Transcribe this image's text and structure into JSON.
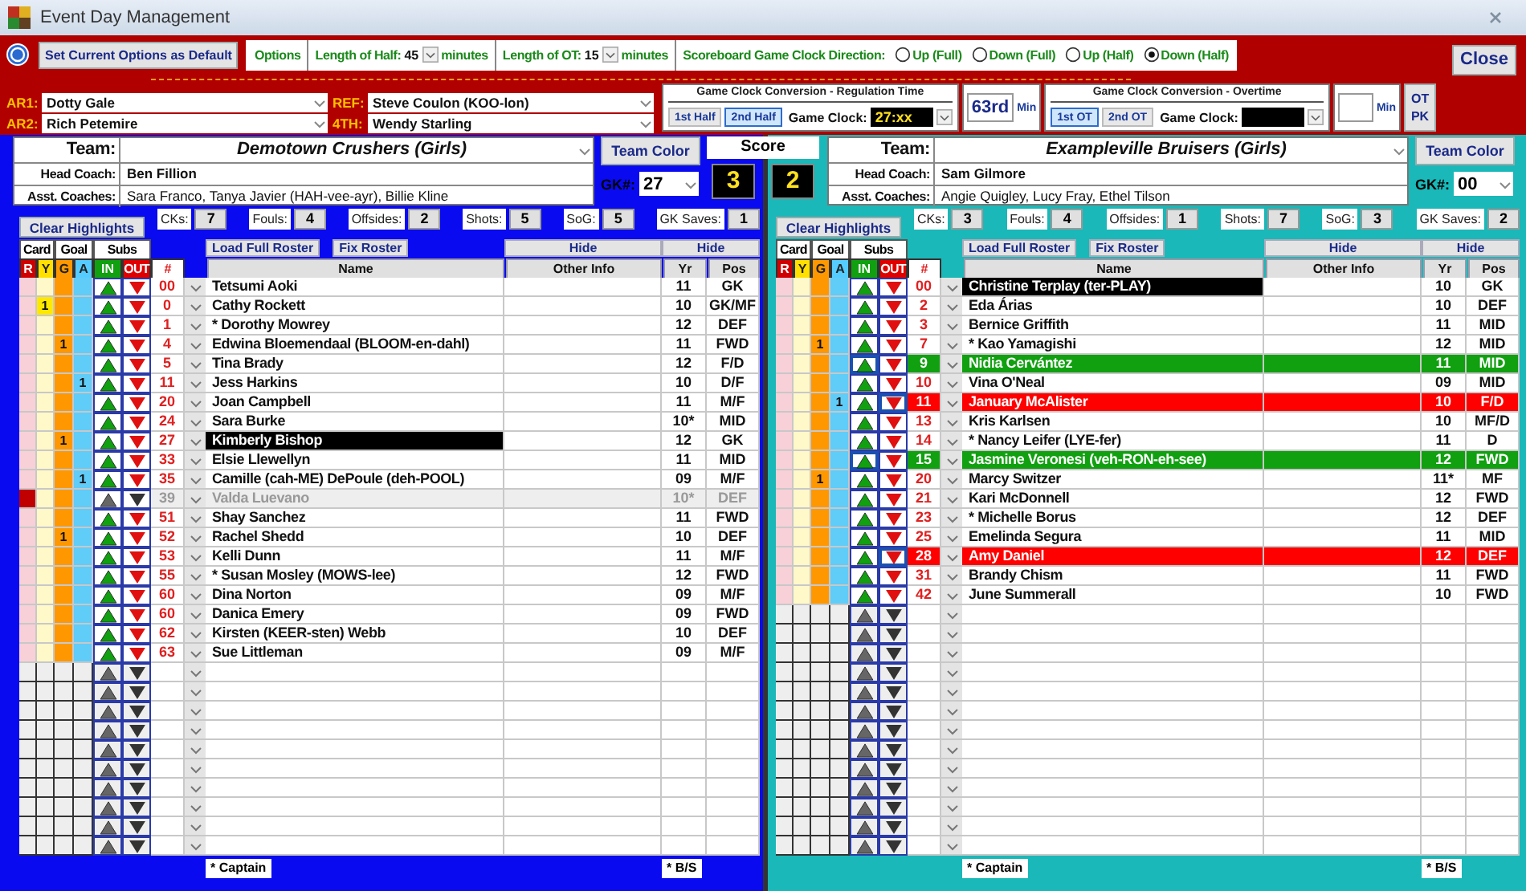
{
  "window": {
    "title": "Event Day Management"
  },
  "options": {
    "default_button": "Set Current Options as Default",
    "label": "Options",
    "half_label": "Length of Half:",
    "half_value": "45",
    "half_unit": "minutes",
    "ot_label": "Length of OT:",
    "ot_value": "15",
    "ot_unit": "minutes",
    "direction_label": "Scoreboard Game Clock Direction:",
    "directions": [
      {
        "label": "Up (Full)",
        "selected": false
      },
      {
        "label": "Down (Full)",
        "selected": false
      },
      {
        "label": "Up (Half)",
        "selected": false
      },
      {
        "label": "Down (Half)",
        "selected": true
      }
    ]
  },
  "close_button": "Close",
  "officials": [
    {
      "role": "AR1:",
      "name": "Dotty Gale"
    },
    {
      "role": "AR2:",
      "name": "Rich Petemire"
    },
    {
      "role": "REF:",
      "name": "Steve Coulon (KOO-lon)"
    },
    {
      "role": "4TH:",
      "name": "Wendy Starling"
    }
  ],
  "regulation": {
    "title": "Game Clock Conversion - Regulation Time",
    "periods": [
      {
        "label": "1st Half",
        "selected": false
      },
      {
        "label": "2nd Half",
        "selected": true
      }
    ],
    "clock_label": "Game Clock:",
    "clock_value": "27:xx",
    "minute": "63rd",
    "minute_unit": "Min"
  },
  "overtime": {
    "title": "Game Clock Conversion - Overtime",
    "periods": [
      {
        "label": "1st OT",
        "selected": true
      },
      {
        "label": "2nd OT",
        "selected": false
      }
    ],
    "clock_label": "Game Clock:",
    "minute_unit": "Min"
  },
  "ot_pk_button": "OT PK",
  "score": {
    "label": "Score",
    "home": "3",
    "away": "2"
  },
  "teams": [
    {
      "color": "#0a0af0",
      "team_label": "Team:",
      "name": "Demotown Crushers (Girls)",
      "color_button": "Team Color",
      "head_coach_label": "Head Coach:",
      "head_coach": "Ben Fillion",
      "asst_label": "Asst. Coaches:",
      "asst": "Sara Franco, Tanya Javier (HAH-vee-ayr), Billie Kline",
      "gk_label": "GK#:",
      "gk": "27",
      "stats": [
        {
          "label": "CKs:",
          "value": "7"
        },
        {
          "label": "Fouls:",
          "value": "4"
        },
        {
          "label": "Offsides:",
          "value": "2"
        },
        {
          "label": "Shots:",
          "value": "5"
        },
        {
          "label": "SoG:",
          "value": "5"
        },
        {
          "label": "GK Saves:",
          "value": "1"
        }
      ],
      "clear_button": "Clear Highlights",
      "group_headers": [
        "Card",
        "Goal",
        "Subs"
      ],
      "load_button": "Load Full Roster",
      "fix_button": "Fix Roster",
      "hide_buttons": [
        "Hide",
        "Hide"
      ],
      "columns": [
        "R",
        "Y",
        "G",
        "A",
        "IN",
        "OUT",
        "#",
        "Name",
        "Other Info",
        "Yr",
        "Pos"
      ],
      "players": [
        {
          "kind": "player",
          "num": "00",
          "name": "Tetsumi Aoki",
          "yr": "11",
          "pos": "GK",
          "red_card": false,
          "in_goal": false,
          "subbed_in": false,
          "subbed_out": false
        },
        {
          "kind": "player",
          "num": "0",
          "name": "Cathy Rockett",
          "yr": "10",
          "pos": "GK/MF",
          "red_card": false,
          "in_goal": false,
          "subbed_in": false,
          "subbed_out": false,
          "yellow": "1"
        },
        {
          "kind": "player",
          "num": "1",
          "name": "* Dorothy Mowrey",
          "yr": "12",
          "pos": "DEF",
          "red_card": false,
          "in_goal": false,
          "subbed_in": false,
          "subbed_out": false
        },
        {
          "kind": "player",
          "num": "4",
          "name": "Edwina Bloemendaal (BLOOM-en-dahl)",
          "yr": "11",
          "pos": "FWD",
          "red_card": false,
          "in_goal": false,
          "subbed_in": false,
          "subbed_out": false,
          "goals": "1"
        },
        {
          "kind": "player",
          "num": "5",
          "name": "Tina Brady",
          "yr": "12",
          "pos": "F/D",
          "red_card": false,
          "in_goal": false,
          "subbed_in": false,
          "subbed_out": false
        },
        {
          "kind": "player",
          "num": "11",
          "name": "Jess Harkins",
          "yr": "10",
          "pos": "D/F",
          "red_card": false,
          "in_goal": false,
          "subbed_in": false,
          "subbed_out": false,
          "assists": "1"
        },
        {
          "kind": "player",
          "num": "20",
          "name": "Joan Campbell",
          "yr": "11",
          "pos": "M/F",
          "red_card": false,
          "in_goal": false,
          "subbed_in": false,
          "subbed_out": false
        },
        {
          "kind": "player",
          "num": "24",
          "name": "Sara Burke",
          "yr": "10*",
          "pos": "MID",
          "red_card": false,
          "in_goal": false,
          "subbed_in": false,
          "subbed_out": false
        },
        {
          "kind": "player",
          "num": "27",
          "name": "Kimberly Bishop",
          "yr": "12",
          "pos": "GK",
          "red_card": false,
          "in_goal": true,
          "subbed_in": false,
          "subbed_out": false,
          "goals": "1"
        },
        {
          "kind": "player",
          "num": "33",
          "name": "Elsie Llewellyn",
          "yr": "11",
          "pos": "MID",
          "red_card": false,
          "in_goal": false,
          "subbed_in": false,
          "subbed_out": false
        },
        {
          "kind": "player",
          "num": "35",
          "name": "Camille (cah-ME) DePoule (deh-POOL)",
          "yr": "09",
          "pos": "M/F",
          "red_card": false,
          "in_goal": false,
          "subbed_in": false,
          "subbed_out": false,
          "assists": "1"
        },
        {
          "kind": "player",
          "num": "39",
          "name": "Valda Luevano",
          "yr": "10*",
          "pos": "DEF",
          "red_card": true,
          "in_goal": false,
          "subbed_in": false,
          "subbed_out": false
        },
        {
          "kind": "player",
          "num": "51",
          "name": "Shay Sanchez",
          "yr": "11",
          "pos": "FWD",
          "red_card": false,
          "in_goal": false,
          "subbed_in": false,
          "subbed_out": false
        },
        {
          "kind": "player",
          "num": "52",
          "name": "Rachel Shedd",
          "yr": "10",
          "pos": "DEF",
          "red_card": false,
          "in_goal": false,
          "subbed_in": false,
          "subbed_out": false,
          "goals": "1"
        },
        {
          "kind": "player",
          "num": "53",
          "name": "Kelli Dunn",
          "yr": "11",
          "pos": "M/F",
          "red_card": false,
          "in_goal": false,
          "subbed_in": false,
          "subbed_out": false
        },
        {
          "kind": "player",
          "num": "55",
          "name": "* Susan Mosley (MOWS-lee)",
          "yr": "12",
          "pos": "FWD",
          "red_card": false,
          "in_goal": false,
          "subbed_in": false,
          "subbed_out": false
        },
        {
          "kind": "player",
          "num": "60",
          "name": "Dina Norton",
          "yr": "09",
          "pos": "M/F",
          "red_card": false,
          "in_goal": false,
          "subbed_in": false,
          "subbed_out": false
        },
        {
          "kind": "player",
          "num": "60",
          "name": "Danica Emery",
          "yr": "09",
          "pos": "FWD",
          "red_card": false,
          "in_goal": false,
          "subbed_in": false,
          "subbed_out": false
        },
        {
          "kind": "player",
          "num": "62",
          "name": "Kirsten (KEER-sten) Webb",
          "yr": "10",
          "pos": "DEF",
          "red_card": false,
          "in_goal": false,
          "subbed_in": false,
          "subbed_out": false
        },
        {
          "kind": "player",
          "num": "63",
          "name": "Sue Littleman",
          "yr": "09",
          "pos": "M/F",
          "red_card": false,
          "in_goal": false,
          "subbed_in": false,
          "subbed_out": false
        },
        {
          "kind": "blank"
        },
        {
          "kind": "blank"
        },
        {
          "kind": "blank"
        },
        {
          "kind": "blank"
        },
        {
          "kind": "blank"
        },
        {
          "kind": "blank"
        },
        {
          "kind": "blank"
        },
        {
          "kind": "blank"
        },
        {
          "kind": "blank"
        },
        {
          "kind": "blank"
        }
      ],
      "footer": [
        "* Captain",
        "* B/S"
      ]
    },
    {
      "color": "#1ab8b8",
      "team_label": "Team:",
      "name": "Exampleville Bruisers (Girls)",
      "color_button": "Team Color",
      "head_coach_label": "Head Coach:",
      "head_coach": "Sam Gilmore",
      "asst_label": "Asst. Coaches:",
      "asst": "Angie Quigley, Lucy Fray, Ethel Tilson",
      "gk_label": "GK#:",
      "gk": "00",
      "stats": [
        {
          "label": "CKs:",
          "value": "3"
        },
        {
          "label": "Fouls:",
          "value": "4"
        },
        {
          "label": "Offsides:",
          "value": "1"
        },
        {
          "label": "Shots:",
          "value": "7"
        },
        {
          "label": "SoG:",
          "value": "3"
        },
        {
          "label": "GK Saves:",
          "value": "2"
        }
      ],
      "clear_button": "Clear Highlights",
      "group_headers": [
        "Card",
        "Goal",
        "Subs"
      ],
      "load_button": "Load Full Roster",
      "fix_button": "Fix Roster",
      "hide_buttons": [
        "Hide",
        "Hide"
      ],
      "columns": [
        "R",
        "Y",
        "G",
        "A",
        "IN",
        "OUT",
        "#",
        "Name",
        "Other Info",
        "Yr",
        "Pos"
      ],
      "players": [
        {
          "kind": "player",
          "num": "00",
          "name": "Christine Terplay (ter-PLAY)",
          "yr": "10",
          "pos": "GK",
          "red_card": false,
          "in_goal": true,
          "subbed_in": false,
          "subbed_out": false
        },
        {
          "kind": "player",
          "num": "2",
          "name": "Eda Árias",
          "yr": "10",
          "pos": "DEF",
          "red_card": false,
          "in_goal": false,
          "subbed_in": false,
          "subbed_out": false
        },
        {
          "kind": "player",
          "num": "3",
          "name": "Bernice Griffith",
          "yr": "11",
          "pos": "MID",
          "red_card": false,
          "in_goal": false,
          "subbed_in": false,
          "subbed_out": false
        },
        {
          "kind": "player",
          "num": "7",
          "name": "* Kao Yamagishi",
          "yr": "12",
          "pos": "MID",
          "red_card": false,
          "in_goal": false,
          "subbed_in": false,
          "subbed_out": false,
          "goals": "1"
        },
        {
          "kind": "player",
          "num": "9",
          "name": "Nidia Cervántez",
          "yr": "11",
          "pos": "MID",
          "red_card": false,
          "in_goal": false,
          "subbed_in": true,
          "subbed_out": false
        },
        {
          "kind": "player",
          "num": "10",
          "name": "Vina O'Neal",
          "yr": "09",
          "pos": "MID",
          "red_card": false,
          "in_goal": false,
          "subbed_in": false,
          "subbed_out": false
        },
        {
          "kind": "player",
          "num": "11",
          "name": "January McAlister",
          "yr": "10",
          "pos": "F/D",
          "red_card": false,
          "in_goal": false,
          "subbed_in": false,
          "subbed_out": true,
          "assists": "1"
        },
        {
          "kind": "player",
          "num": "13",
          "name": "Kris Karlsen",
          "yr": "10",
          "pos": "MF/D",
          "red_card": false,
          "in_goal": false,
          "subbed_in": false,
          "subbed_out": false
        },
        {
          "kind": "player",
          "num": "14",
          "name": "* Nancy Leifer (LYE-fer)",
          "yr": "11",
          "pos": "D",
          "red_card": false,
          "in_goal": false,
          "subbed_in": false,
          "subbed_out": false
        },
        {
          "kind": "player",
          "num": "15",
          "name": "Jasmine Veronesi (veh-RON-eh-see)",
          "yr": "12",
          "pos": "FWD",
          "red_card": false,
          "in_goal": false,
          "subbed_in": true,
          "subbed_out": false
        },
        {
          "kind": "player",
          "num": "20",
          "name": "Marcy Switzer",
          "yr": "11*",
          "pos": "MF",
          "red_card": false,
          "in_goal": false,
          "subbed_in": false,
          "subbed_out": false,
          "goals": "1"
        },
        {
          "kind": "player",
          "num": "21",
          "name": "Kari McDonnell",
          "yr": "12",
          "pos": "FWD",
          "red_card": false,
          "in_goal": false,
          "subbed_in": false,
          "subbed_out": false
        },
        {
          "kind": "player",
          "num": "23",
          "name": "* Michelle Borus",
          "yr": "12",
          "pos": "DEF",
          "red_card": false,
          "in_goal": false,
          "subbed_in": false,
          "subbed_out": false
        },
        {
          "kind": "player",
          "num": "25",
          "name": "Emelinda Segura",
          "yr": "11",
          "pos": "MID",
          "red_card": false,
          "in_goal": false,
          "subbed_in": false,
          "subbed_out": false
        },
        {
          "kind": "player",
          "num": "28",
          "name": "Amy Daniel",
          "yr": "12",
          "pos": "DEF",
          "red_card": false,
          "in_goal": false,
          "subbed_in": false,
          "subbed_out": true
        },
        {
          "kind": "player",
          "num": "31",
          "name": "Brandy Chism",
          "yr": "11",
          "pos": "FWD",
          "red_card": false,
          "in_goal": false,
          "subbed_in": false,
          "subbed_out": false
        },
        {
          "kind": "player",
          "num": "42",
          "name": "June Summerall",
          "yr": "10",
          "pos": "FWD",
          "red_card": false,
          "in_goal": false,
          "subbed_in": false,
          "subbed_out": false
        },
        {
          "kind": "blank"
        },
        {
          "kind": "blank"
        },
        {
          "kind": "blank"
        },
        {
          "kind": "blank"
        },
        {
          "kind": "blank"
        },
        {
          "kind": "blank"
        },
        {
          "kind": "blank"
        },
        {
          "kind": "blank"
        },
        {
          "kind": "blank"
        },
        {
          "kind": "blank"
        },
        {
          "kind": "blank"
        },
        {
          "kind": "blank"
        },
        {
          "kind": "blank"
        }
      ],
      "footer": [
        "* Captain",
        "* B/S"
      ]
    }
  ]
}
